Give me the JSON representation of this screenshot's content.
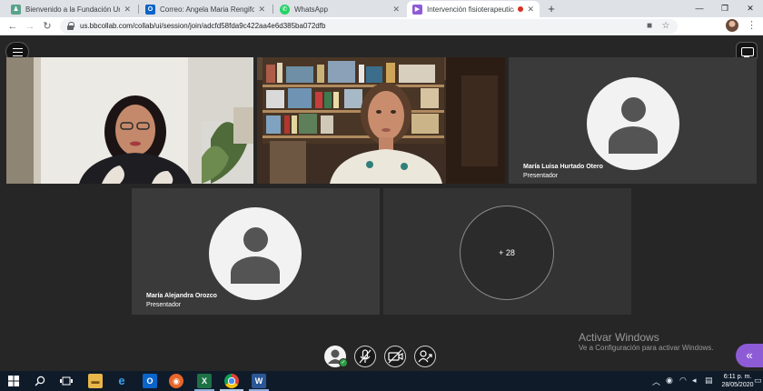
{
  "browser": {
    "tabs": [
      {
        "title": "Bienvenido a la Fundación Unive",
        "favicon": "university-icon",
        "close": "✕"
      },
      {
        "title": "Correo: Angela Maria Rengifo Te",
        "favicon": "outlook-icon",
        "close": "✕"
      },
      {
        "title": "WhatsApp",
        "favicon": "whatsapp-icon",
        "close": "✕"
      },
      {
        "title": "Intervención fisioterapeutica",
        "favicon": "blackboard-icon",
        "close": "✕",
        "active": true
      }
    ],
    "new_tab": "+",
    "window_controls": {
      "minimize": "—",
      "maximize": "❐",
      "close": "✕"
    },
    "url": "us.bbcollab.com/collab/ui/session/join/adcfd58fda9c422aa4e6d385ba072dfb",
    "icons": [
      "back-icon",
      "forward-icon",
      "reload-icon",
      "lock-icon",
      "camera-icon",
      "star-icon"
    ]
  },
  "session": {
    "participants": [
      {
        "name": "",
        "role": "",
        "type": "video"
      },
      {
        "name": "",
        "role": "",
        "type": "video"
      },
      {
        "name": "María Luisa Hurtado Otero",
        "role": "Presentador",
        "type": "avatar"
      },
      {
        "name": "María Alejandra Orozco",
        "role": "Presentador",
        "type": "avatar"
      }
    ],
    "more_participants": "+ 28",
    "controls": [
      "profile-status",
      "microphone-muted",
      "camera-off",
      "share-content"
    ],
    "accent_color": "#8e5bd6"
  },
  "watermark": {
    "title": "Activar Windows",
    "subtitle": "Ve a Configuración para activar Windows."
  },
  "taskbar": {
    "apps": [
      "file-explorer-icon",
      "edge-icon",
      "outlook-icon",
      "firefox-icon",
      "excel-icon",
      "chrome-icon",
      "word-icon"
    ],
    "time": "6:11 p. m.",
    "date": "28/05/2020"
  }
}
